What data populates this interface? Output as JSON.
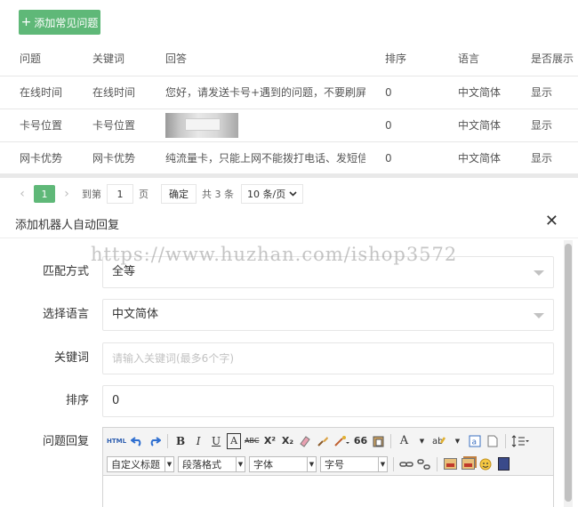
{
  "top": {
    "add_button": "添加常见问题",
    "add_plus": "+",
    "columns": [
      "问题",
      "关键词",
      "回答",
      "排序",
      "语言",
      "是否展示"
    ],
    "rows": [
      {
        "question": "在线时间",
        "keyword": "在线时间",
        "answer": "您好，请发送卡号+遇到的问题，不要刷屏，这边",
        "sort": "0",
        "lang": "中文简体",
        "show": "显示"
      },
      {
        "question": "卡号位置",
        "keyword": "卡号位置",
        "answer": "",
        "sort": "0",
        "lang": "中文简体",
        "show": "显示"
      },
      {
        "question": "网卡优势",
        "keyword": "网卡优势",
        "answer": "纯流量卡，只能上网不能拨打电话、发短信，流量",
        "sort": "0",
        "lang": "中文简体",
        "show": "显示"
      }
    ]
  },
  "pager": {
    "prev": "‹",
    "current": "1",
    "next": "›",
    "goto": "到第",
    "page_value": "1",
    "page_unit": "页",
    "confirm": "确定",
    "total": "共 3 条",
    "size": "10 条/页"
  },
  "modal": {
    "title": "添加机器人自动回复",
    "close": "✕",
    "watermark": "https://www.huzhan.com/ishop3572",
    "match_label": "匹配方式",
    "match_value": "全等",
    "lang_label": "选择语言",
    "lang_value": "中文简体",
    "keyword_label": "关键词",
    "keyword_placeholder": "请输入关键词(最多6个字)",
    "sort_label": "排序",
    "sort_value": "0",
    "reply_label": "问题回复"
  },
  "editor": {
    "html": "HTML",
    "bold": "B",
    "italic": "I",
    "underline": "U",
    "fontborder": "A",
    "strike": "ABC",
    "sup": "X²",
    "sub": "X₂",
    "quote": "66",
    "forecolor": "A",
    "customstyle": "自定义标题",
    "paragraph": "段落格式",
    "fontfamily": "字体",
    "fontsize": "字号"
  }
}
